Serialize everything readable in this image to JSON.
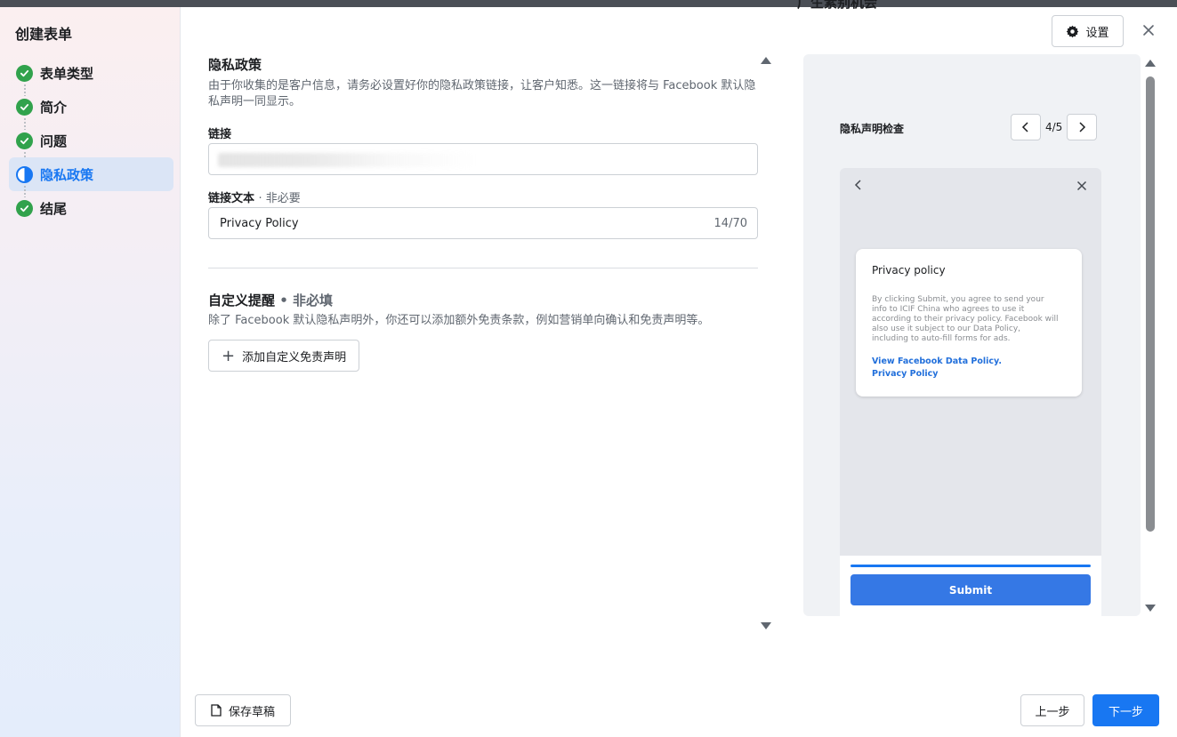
{
  "background": {
    "partial_text": "广生素别机会"
  },
  "sidebar": {
    "title": "创建表单",
    "steps": [
      {
        "label": "表单类型",
        "status": "done"
      },
      {
        "label": "简介",
        "status": "done"
      },
      {
        "label": "问题",
        "status": "done"
      },
      {
        "label": "隐私政策",
        "status": "active"
      },
      {
        "label": "结尾",
        "status": "done"
      }
    ]
  },
  "header": {
    "settings_label": "设置",
    "close_icon": "close-icon",
    "settings_icon": "gear-icon"
  },
  "privacy": {
    "title": "隐私政策",
    "description": "由于你收集的是客户信息，请务必设置好你的隐私政策链接，让客户知悉。这一链接将与 Facebook 默认隐私声明一同显示。",
    "link_label": "链接",
    "link_value": "",
    "link_text_label": "链接文本",
    "link_text_optional": "· 非必要",
    "link_text_value": "Privacy Policy",
    "link_text_counter": "14/70"
  },
  "custom_disclaimer": {
    "title": "自定义提醒",
    "optional": "• 非必填",
    "description": "除了 Facebook 默认隐私声明外，你还可以添加额外免责条款，例如营销单向确认和免责声明等。",
    "add_button_label": "添加自定义免责声明"
  },
  "preview": {
    "title": "隐私声明检查",
    "page_counter": "4/5",
    "card": {
      "title": "Privacy policy",
      "body": "By clicking Submit, you agree to send your info to ICIF China who agrees to use it according to their privacy policy. Facebook will also use it subject to our Data Policy, including to auto-fill forms for ads.",
      "link1": "View Facebook Data Policy.",
      "link2": "Privacy Policy"
    },
    "submit_label": "Submit",
    "progress": 1.0
  },
  "footer": {
    "save_draft_label": "保存草稿",
    "prev_label": "上一步",
    "next_label": "下一步"
  },
  "colors": {
    "accent": "#1877f2",
    "success": "#31a24c",
    "submit": "#3578e5",
    "link": "#216fdb"
  }
}
